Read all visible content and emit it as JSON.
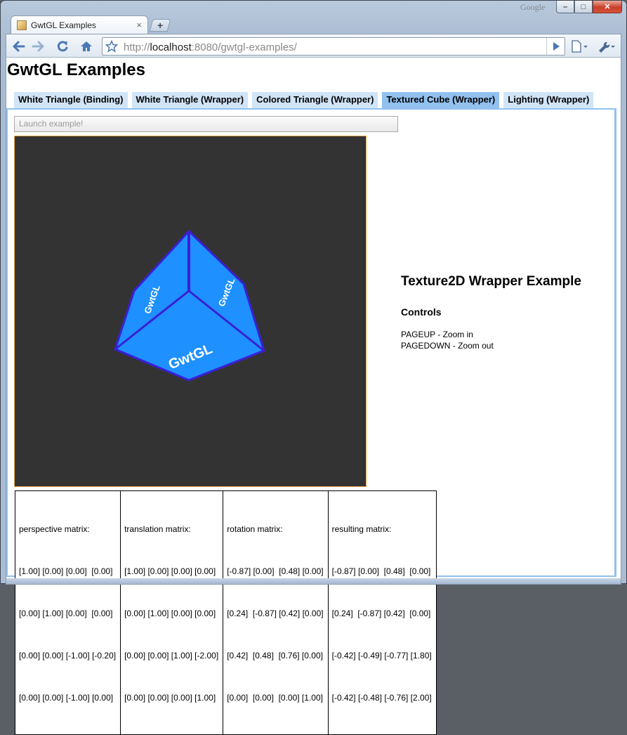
{
  "browser": {
    "brand": "Google",
    "tab_title": "GwtGL Examples",
    "tab_close": "×",
    "new_tab": "+",
    "url_scheme": "http://",
    "url_host": "localhost",
    "url_rest": ":8080/gwtgl-examples/"
  },
  "page": {
    "title": "GwtGL Examples",
    "tabs": [
      {
        "label": "White Triangle (Binding)",
        "active": false
      },
      {
        "label": "White Triangle (Wrapper)",
        "active": false
      },
      {
        "label": "Colored Triangle (Wrapper)",
        "active": false
      },
      {
        "label": "Textured Cube (Wrapper)",
        "active": true
      },
      {
        "label": "Lighting (Wrapper)",
        "active": false
      }
    ],
    "launch_button": "Launch example!",
    "cube_texture_text": "GwtGL",
    "description": {
      "heading": "Texture2D Wrapper Example",
      "controls_heading": "Controls",
      "controls": [
        "PAGEUP - Zoom in",
        "PAGEDOWN - Zoom out"
      ]
    },
    "matrices": [
      {
        "title": "perspective matrix:",
        "rows": [
          "[1.00] [0.00] [0.00]  [0.00]",
          "[0.00] [1.00] [0.00]  [0.00]",
          "[0.00] [0.00] [-1.00] [-0.20]",
          "[0.00] [0.00] [-1.00] [0.00]"
        ]
      },
      {
        "title": "translation matrix:",
        "rows": [
          "[1.00] [0.00] [0.00] [0.00]",
          "[0.00] [1.00] [0.00] [0.00]",
          "[0.00] [0.00] [1.00] [-2.00]",
          "[0.00] [0.00] [0.00] [1.00]"
        ]
      },
      {
        "title": "rotation matrix:",
        "rows": [
          "[-0.87] [0.00]  [0.48] [0.00]",
          "[0.24]  [-0.87] [0.42] [0.00]",
          "[0.42]  [0.48]  [0.76] [0.00]",
          "[0.00]  [0.00]  [0.00] [1.00]"
        ]
      },
      {
        "title": "resulting matrix:",
        "rows": [
          "[-0.87] [0.00]  [0.48]  [0.00]",
          "[0.24]  [-0.87] [0.42]  [0.00]",
          "[-0.42] [-0.49] [-0.77] [1.80]",
          "[-0.42] [-0.48] [-0.76] [2.00]"
        ]
      }
    ]
  },
  "colors": {
    "tab_inactive": "#d1e4f8",
    "tab_active": "#92c1ef",
    "canvas_bg": "#333333",
    "cube_face": "#1e90ff",
    "cube_edge": "#3a1fd6"
  },
  "icons": [
    "back-icon",
    "forward-icon",
    "reload-icon",
    "home-icon",
    "star-icon",
    "go-icon",
    "page-menu-icon",
    "wrench-icon"
  ]
}
